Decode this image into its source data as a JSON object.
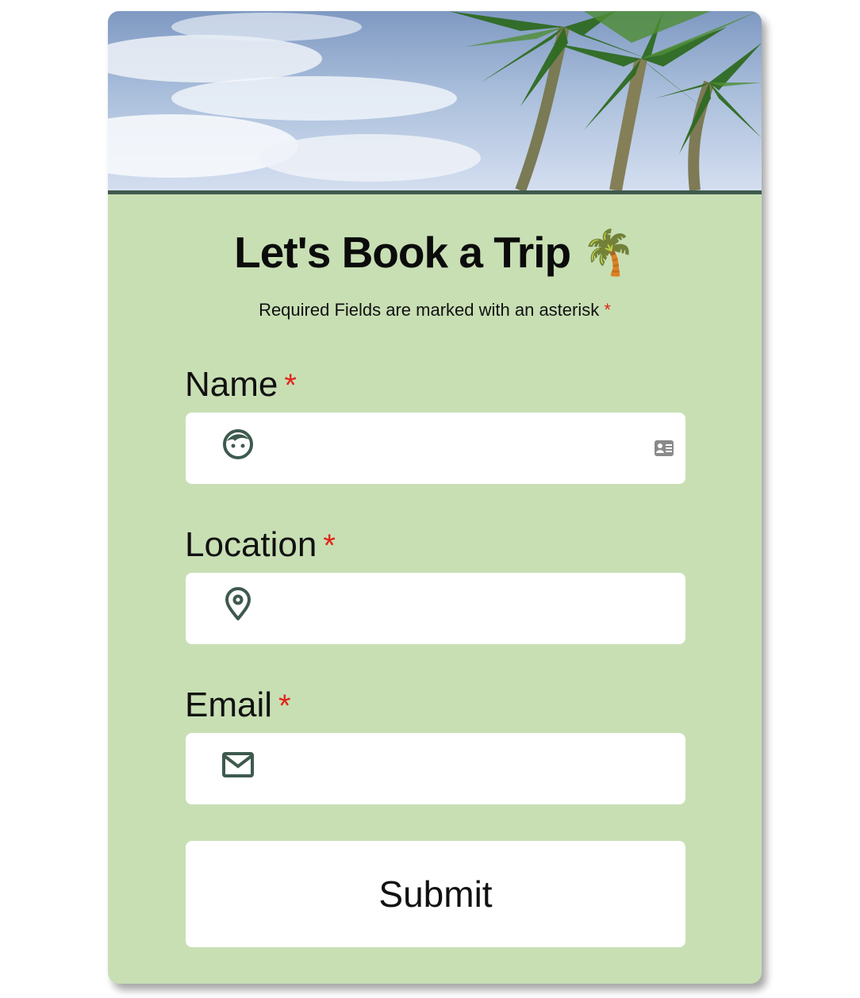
{
  "form": {
    "title": "Let's Book a Trip",
    "title_emoji": "🌴",
    "subtitle": "Required Fields are marked with an asterisk",
    "required_marker": "*",
    "fields": [
      {
        "label": "Name",
        "value": "",
        "placeholder": "",
        "icon": "face-icon"
      },
      {
        "label": "Location",
        "value": "",
        "placeholder": "",
        "icon": "map-pin-icon"
      },
      {
        "label": "Email",
        "value": "",
        "placeholder": "",
        "icon": "mail-icon"
      }
    ],
    "submit_label": "Submit"
  },
  "colors": {
    "background": "#c8dfb4",
    "accent": "#3e5a4e",
    "required": "#e1251b"
  }
}
